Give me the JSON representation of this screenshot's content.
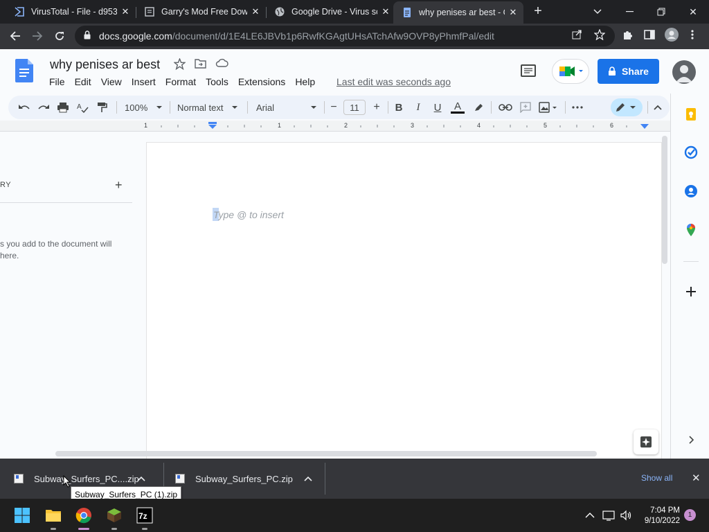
{
  "browser": {
    "tabs": [
      {
        "title": "VirusTotal - File - d953",
        "active": false
      },
      {
        "title": "Garry's Mod Free Down",
        "active": false
      },
      {
        "title": "Google Drive - Virus sc",
        "active": false
      },
      {
        "title": "why penises ar best - G",
        "active": true
      }
    ],
    "url_host": "docs.google.com",
    "url_path": "/document/d/1E4LE6JBVb1p6RwfKGAgtUHsATchAfw9OVP8yPhmfPal/edit"
  },
  "docs": {
    "title": "why penises ar best",
    "menu": [
      "File",
      "Edit",
      "View",
      "Insert",
      "Format",
      "Tools",
      "Extensions",
      "Help"
    ],
    "last_edit": "Last edit was seconds ago",
    "share_label": "Share",
    "toolbar": {
      "zoom": "100%",
      "style": "Normal text",
      "font": "Arial",
      "font_size": "11",
      "bold": "B",
      "italic": "I",
      "underline": "U",
      "text_color": "A"
    },
    "ruler_numbers": [
      "1",
      "1",
      "2",
      "3",
      "4",
      "5",
      "6"
    ],
    "outline_title": "RY",
    "outline_text": "s you add to the document will\nhere.",
    "placeholder": "Type @ to insert"
  },
  "downloads": {
    "items": [
      {
        "name": "Subway_Surfers_PC....zip"
      },
      {
        "name": "Subway_Surfers_PC.zip"
      }
    ],
    "show_all": "Show all",
    "tooltip": "Subway_Surfers_PC (1).zip"
  },
  "taskbar": {
    "time": "7:04 PM",
    "date": "9/10/2022",
    "notification_count": "1"
  },
  "colors": {
    "share": "#1a73e8",
    "chrome_dark": "#202124",
    "chrome_toolbar": "#35363a"
  }
}
